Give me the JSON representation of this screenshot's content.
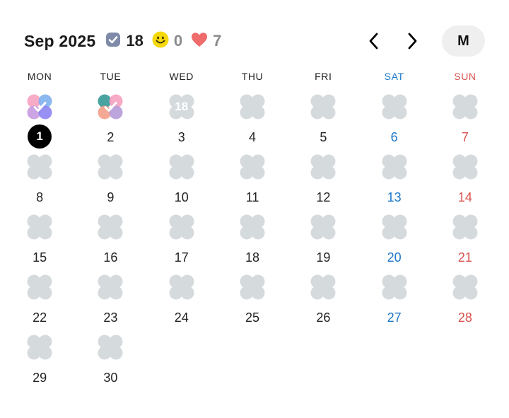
{
  "header": {
    "title": "Sep 2025",
    "done_count": "18",
    "mood_count": "0",
    "love_count": "7",
    "view_mode": "M",
    "icons": {
      "done": "checkbox-icon",
      "mood": "smiley-icon",
      "love": "heart-icon",
      "prev": "chevron-left-icon",
      "next": "chevron-right-icon"
    },
    "colors": {
      "done_icon": "#7e8aa8",
      "mood_icon": "#f5d90a",
      "love_icon": "#f06b6b"
    }
  },
  "weekdays": [
    "MON",
    "TUE",
    "WED",
    "THU",
    "FRI",
    "SAT",
    "SUN"
  ],
  "colors": {
    "saturday": "#1e78c8",
    "sunday": "#d9534f",
    "empty_blob": "#d5dadd",
    "today_bg": "#000000"
  },
  "days": [
    {
      "date": "1",
      "dow": "mon",
      "today": true,
      "blob": "gradient-check"
    },
    {
      "date": "2",
      "dow": "tue",
      "blob": "gradient-check"
    },
    {
      "date": "3",
      "dow": "wed",
      "blob": "count",
      "count": "18"
    },
    {
      "date": "4",
      "dow": "thu"
    },
    {
      "date": "5",
      "dow": "fri"
    },
    {
      "date": "6",
      "dow": "sat"
    },
    {
      "date": "7",
      "dow": "sun"
    },
    {
      "date": "8",
      "dow": "mon"
    },
    {
      "date": "9",
      "dow": "tue"
    },
    {
      "date": "10",
      "dow": "wed"
    },
    {
      "date": "11",
      "dow": "thu"
    },
    {
      "date": "12",
      "dow": "fri"
    },
    {
      "date": "13",
      "dow": "sat"
    },
    {
      "date": "14",
      "dow": "sun"
    },
    {
      "date": "15",
      "dow": "mon"
    },
    {
      "date": "16",
      "dow": "tue"
    },
    {
      "date": "17",
      "dow": "wed"
    },
    {
      "date": "18",
      "dow": "thu"
    },
    {
      "date": "19",
      "dow": "fri"
    },
    {
      "date": "20",
      "dow": "sat"
    },
    {
      "date": "21",
      "dow": "sun"
    },
    {
      "date": "22",
      "dow": "mon"
    },
    {
      "date": "23",
      "dow": "tue"
    },
    {
      "date": "24",
      "dow": "wed"
    },
    {
      "date": "25",
      "dow": "thu"
    },
    {
      "date": "26",
      "dow": "fri"
    },
    {
      "date": "27",
      "dow": "sat"
    },
    {
      "date": "28",
      "dow": "sun"
    },
    {
      "date": "29",
      "dow": "mon"
    },
    {
      "date": "30",
      "dow": "tue"
    }
  ]
}
